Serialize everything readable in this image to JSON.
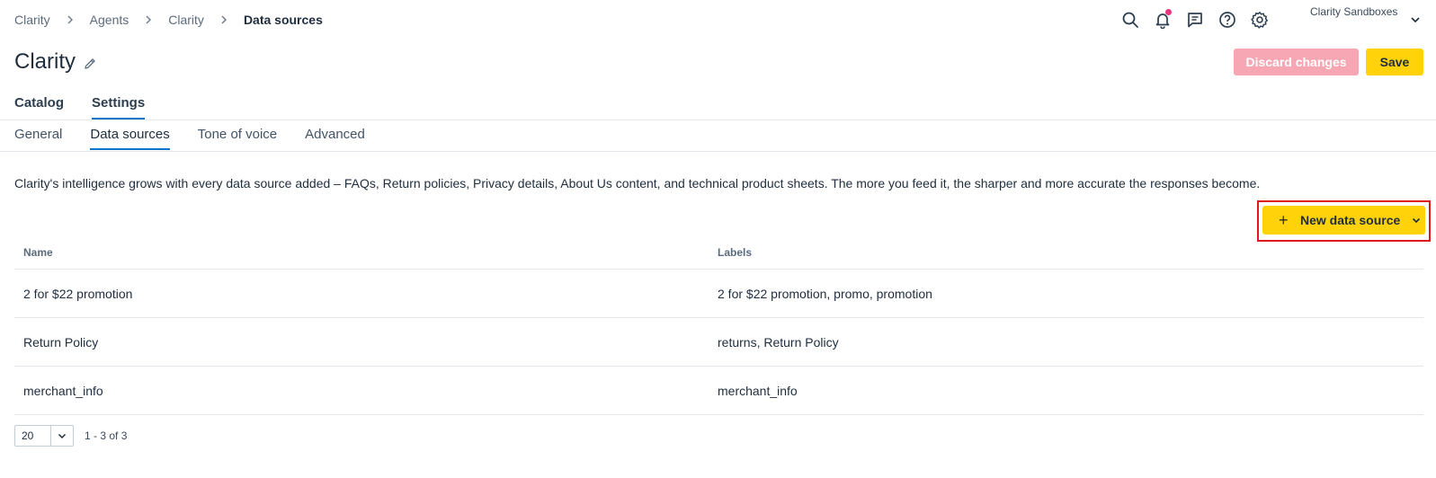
{
  "breadcrumb": {
    "items": [
      "Clarity",
      "Agents",
      "Clarity"
    ],
    "current": "Data sources"
  },
  "account": {
    "name": "Clarity Sandboxes"
  },
  "header": {
    "title": "Clarity",
    "discard_label": "Discard changes",
    "save_label": "Save"
  },
  "tabs": [
    {
      "label": "Catalog",
      "active": false
    },
    {
      "label": "Settings",
      "active": true
    }
  ],
  "subtabs": [
    {
      "label": "General",
      "active": false
    },
    {
      "label": "Data sources",
      "active": true
    },
    {
      "label": "Tone of voice",
      "active": false
    },
    {
      "label": "Advanced",
      "active": false
    }
  ],
  "intro_text": "Clarity's intelligence grows with every data source added – FAQs, Return policies, Privacy details, About Us content, and technical product sheets. The more you feed it, the sharper and more accurate the responses become.",
  "new_data_source": {
    "plus": "+",
    "label": "New data source"
  },
  "table": {
    "columns": [
      "Name",
      "Labels"
    ],
    "rows": [
      {
        "name": "2 for $22 promotion",
        "labels": "2 for $22 promotion, promo, promotion"
      },
      {
        "name": "Return Policy",
        "labels": "returns, Return Policy"
      },
      {
        "name": "merchant_info",
        "labels": "merchant_info"
      }
    ]
  },
  "pagination": {
    "page_size": "20",
    "range": "1 - 3 of 3"
  },
  "colors": {
    "accent_yellow": "#ffd20a",
    "discard_pink": "#f6a7b3",
    "highlight_red": "#e0191f",
    "tab_underline": "#0a74c9",
    "notification_dot": "#e8377f"
  },
  "icons": [
    "search-icon",
    "bell-icon",
    "chat-icon",
    "help-icon",
    "gear-icon",
    "pencil-icon",
    "chevron-right-icon",
    "chevron-down-icon",
    "plus-icon"
  ]
}
